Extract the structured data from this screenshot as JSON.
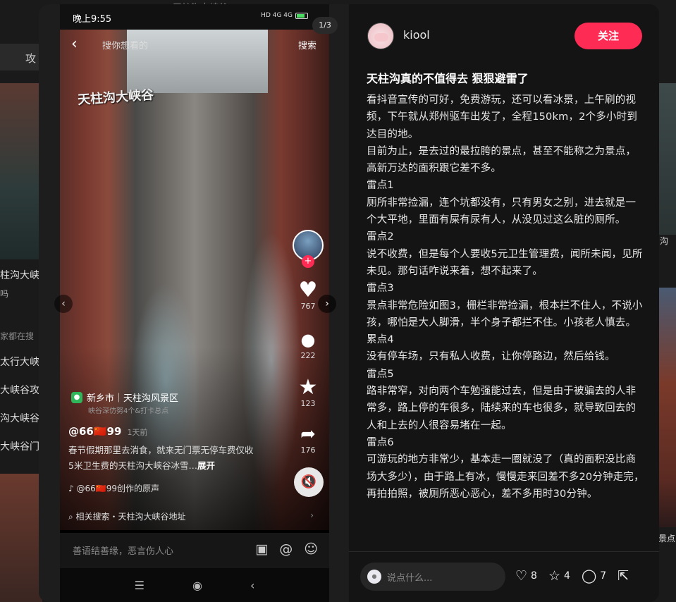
{
  "background": {
    "search_text": "天柱沟大峡谷",
    "tab_label": "攻",
    "left_texts": [
      "柱沟大峡",
      "吗",
      "家都在搜",
      "太行大峡",
      "大峡谷攻",
      "沟大峡谷",
      "大峡谷门"
    ],
    "right_texts": [
      "沟",
      "景点"
    ]
  },
  "media": {
    "status": {
      "time": "晚上9:55",
      "signal": "HD 4G 4G",
      "battery": "56"
    },
    "counter": "1/3",
    "search_placeholder": "搜你想看的",
    "search_button": "搜索",
    "watermark": "天柱沟大峡谷",
    "rail": {
      "likes": "767",
      "comments": "222",
      "favorites": "123",
      "shares": "176"
    },
    "location": "新乡市｜天柱沟风景区",
    "location_sub": "峡谷深仿努4个&打卡总点",
    "author": "@66🇨🇳99",
    "author_date": "1天前",
    "caption": "春节假期那里去消食，就来无门票无停车费仅收5米卫生费的天柱沟大峡谷冰雪…",
    "caption_more": "展开",
    "music": "@66🇨🇳99创作的原声",
    "related": "相关搜索・天柱沟大峡谷地址",
    "comment_placeholder": "善语结善缘，恶言伤人心"
  },
  "panel": {
    "username": "kiool",
    "follow_label": "关注",
    "title": "天柱沟真的不值得去 狠狠避雷了",
    "body": "看抖音宣传的可好，免费游玩，还可以看冰景，上午刷的视频，下午就从郑州驱车出发了，全程150km，2个多小时到达目的地。\n目前为止，是去过的最拉胯的景点，甚至不能称之为景点，高新万达的面积跟它差不多。\n雷点1\n厕所非常捡漏，连个坑都没有，只有男女之别，进去就是一个大平地，里面有屎有尿有人，从没见过这么脏的厕所。\n雷点2\n说不收费，但是每个人要收5元卫生管理费，闻所未闻，见所未见。那句话咋说来着，想不起来了。\n雷点3\n景点非常危险如图3，栅栏非常捡漏，根本拦不住人，不说小孩，哪怕是大人脚滑，半个身子都拦不住。小孩老人慎去。\n累点4\n没有停车场，只有私人收费，让你停路边，然后给钱。\n雷点5\n路非常窄，对向两个车勉强能过去，但是由于被骗去的人非常多，路上停的车很多，陆续来的车也很多，就导致回去的人和上去的人很容易堵在一起。\n雷点6\n可游玩的地方非常少，基本走一圈就没了（真的面积没比商场大多少），由于路上有冰，慢慢走来回差不多20分钟走完，再拍拍照，被厕所恶心恶心，差不多用时30分钟。",
    "comment_placeholder": "说点什么...",
    "likes": "8",
    "favorites": "4",
    "comments": "7"
  }
}
